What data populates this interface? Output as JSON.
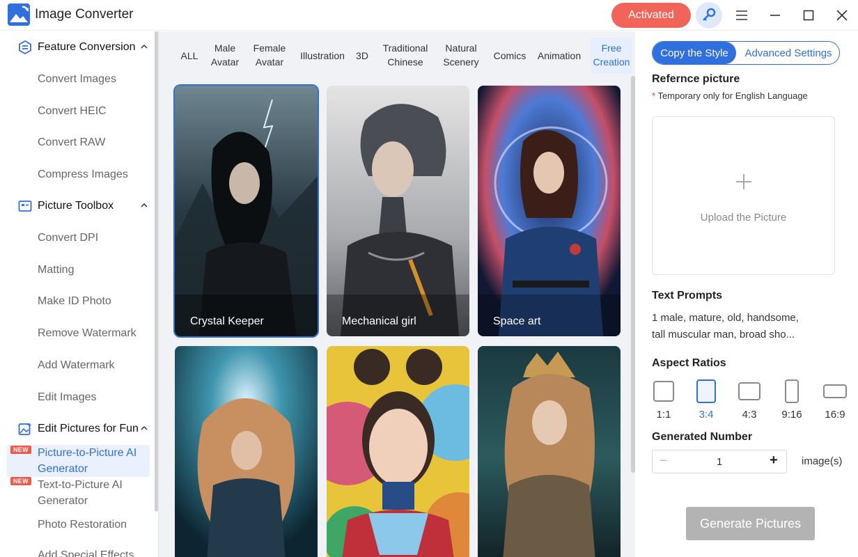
{
  "app": {
    "title": "Image Converter",
    "activated_label": "Activated",
    "accent": "#2f6fde",
    "activated_color": "#f0645a"
  },
  "sidebar": {
    "sections": [
      {
        "label": "Feature Conversion",
        "icon": "feature-conversion-icon"
      },
      {
        "label": "Picture Toolbox",
        "icon": "picture-toolbox-icon"
      },
      {
        "label": "Edit Pictures for Fun",
        "icon": "edit-fun-icon"
      }
    ],
    "items": [
      "Convert Images",
      "Convert HEIC",
      "Convert RAW",
      "Compress Images",
      "Convert DPI",
      "Matting",
      "Make ID Photo",
      "Remove Watermark",
      "Add Watermark",
      "Edit Images",
      "Photo Restoration",
      "Add Special Effects"
    ],
    "new_items": [
      {
        "label": "Picture-to-Picture AI Generator",
        "badge": "NEW"
      },
      {
        "label": "Text-to-Picture AI Generator",
        "badge": "NEW"
      }
    ]
  },
  "tabs": [
    {
      "line1": "ALL",
      "line2": ""
    },
    {
      "line1": "Male",
      "line2": "Avatar"
    },
    {
      "line1": "Female",
      "line2": "Avatar"
    },
    {
      "line1": "Illustration",
      "line2": ""
    },
    {
      "line1": "3D",
      "line2": ""
    },
    {
      "line1": "Traditional",
      "line2": "Chinese"
    },
    {
      "line1": "Natural",
      "line2": "Scenery"
    },
    {
      "line1": "Comics",
      "line2": ""
    },
    {
      "line1": "Animation",
      "line2": ""
    },
    {
      "line1": "Free",
      "line2": "Creation"
    }
  ],
  "gallery": [
    {
      "label": "Crystal Keeper"
    },
    {
      "label": "Mechanical girl"
    },
    {
      "label": "Space art"
    },
    {
      "label": ""
    },
    {
      "label": ""
    },
    {
      "label": ""
    }
  ],
  "panel": {
    "seg_copy": "Copy the Style",
    "seg_advanced": "Advanced Settings",
    "ref_title": "Refernce picture",
    "ref_note_star": "*",
    "ref_note": " Temporary only for English Language",
    "upload_label": "Upload the Picture",
    "prompts_title": "Text Prompts",
    "prompt_line1": "1 male, mature, old, handsome,",
    "prompt_line2": "tall muscular man, broad sho...",
    "ratios_title": "Aspect Ratios",
    "ratios": [
      "1:1",
      "3:4",
      "4:3",
      "9:16",
      "16:9"
    ],
    "selected_ratio": "3:4",
    "number_title": "Generated Number",
    "number_value": "1",
    "minus": "−",
    "plus": "+",
    "number_unit": "image(s)",
    "generate_label": "Generate Pictures"
  }
}
